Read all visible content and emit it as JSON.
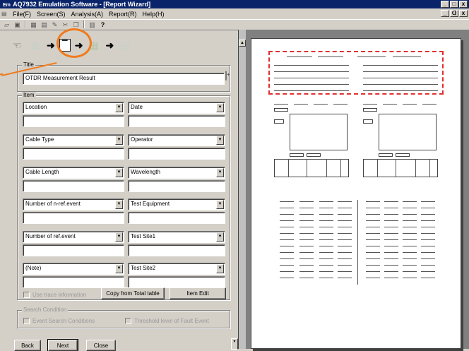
{
  "window": {
    "title": "AQ7932 Emulation Software - [Report Wizard]",
    "app_icon": "Em",
    "minimize": "_",
    "restore": "□",
    "close": "x"
  },
  "menu": {
    "items": [
      "File(F)",
      "Screen(S)",
      "Analysis(A)",
      "Report(R)",
      "Help(H)"
    ],
    "mdi_min": "_",
    "mdi_restore": "ᗡ",
    "mdi_close": "x"
  },
  "toolbar": {
    "icons": [
      "open-icon",
      "save-icon",
      "print-icon",
      "preview-icon",
      "tool-icon",
      "cut-icon",
      "copy-icon",
      "paste-icon",
      "help-icon"
    ],
    "help_glyph": "?"
  },
  "wizard": {
    "steps": [
      "trace-step-icon",
      "title-step-icon",
      "map-step-icon",
      "event-step-icon"
    ],
    "arrow": "➜",
    "title_group": {
      "label": "Title",
      "value": "OTDR Measurement Result"
    },
    "item_group": {
      "label": "Item",
      "rows": [
        {
          "left": "Location",
          "right": "Date"
        },
        {
          "left": "Cable Type",
          "right": "Operator"
        },
        {
          "left": "Cable Length",
          "right": "Wavelength"
        },
        {
          "left": "Number of n-ref.event",
          "right": "Test Equipment"
        },
        {
          "left": "Number of ref.event",
          "right": "Test Site1"
        },
        {
          "left": "(Note)",
          "right": "Test Site2"
        }
      ],
      "use_trace_info": "Use trace information",
      "copy_button": "Copy from Total table",
      "item_edit_button": "Item Edit"
    },
    "search_group": {
      "label": "Search Condition",
      "event_search": "Event Search Conditions",
      "threshold": "Threshold level of Fault Event"
    },
    "buttons": {
      "back": "Back",
      "next": "Next",
      "close": "Close"
    }
  },
  "colors": {
    "titlebar": "#0a246a",
    "highlight": "#f07b1e",
    "preview_selection": "#e03030"
  }
}
